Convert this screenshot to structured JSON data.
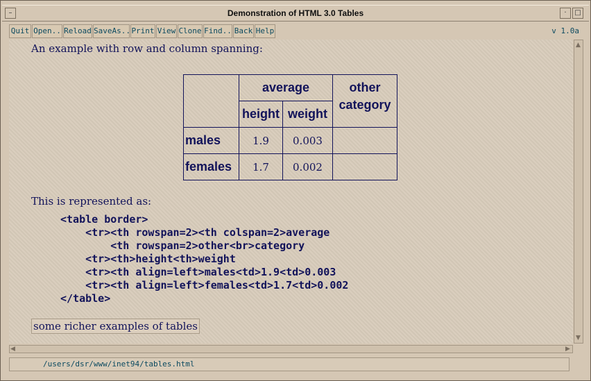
{
  "window": {
    "title": "Demonstration of HTML 3.0 Tables"
  },
  "toolbar": {
    "buttons": [
      "Quit",
      "Open..",
      "Reload",
      "SaveAs..",
      "Print",
      "View",
      "Clone",
      "Find..",
      "Back",
      "Help"
    ],
    "version": "v 1.0a"
  },
  "content": {
    "intro": "An example with row and column spanning:",
    "table": {
      "header_average": "average",
      "header_other_1": "other",
      "header_other_2": "category",
      "header_height": "height",
      "header_weight": "weight",
      "rows": [
        {
          "label": "males",
          "height": "1.9",
          "weight": "0.003"
        },
        {
          "label": "females",
          "height": "1.7",
          "weight": "0.002"
        }
      ]
    },
    "represented": "This is represented as:",
    "code_lines": [
      "<table border>",
      "    <tr><th rowspan=2><th colspan=2>average",
      "        <th rowspan=2>other<br>category",
      "    <tr><th>height<th>weight",
      "    <tr><th align=left>males<td>1.9<td>0.003",
      "    <tr><th align=left>females<td>1.7<td>0.002",
      "</table>"
    ],
    "link": "some richer examples of tables"
  },
  "status": {
    "path": "/users/dsr/www/inet94/tables.html"
  }
}
